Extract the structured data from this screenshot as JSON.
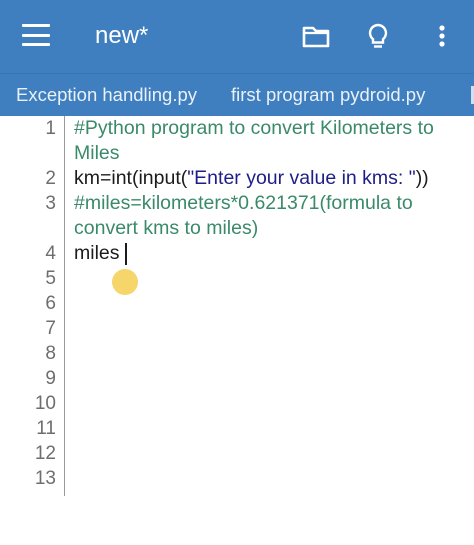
{
  "app_bar": {
    "title": "new*",
    "icons": [
      "menu-icon",
      "folder-icon",
      "lightbulb-icon",
      "more-vert-icon"
    ],
    "background": "#3f7fbf"
  },
  "tabs": [
    {
      "label": "Exception handling.py"
    },
    {
      "label": "first program pydroid.py"
    }
  ],
  "editor": {
    "line_numbers": [
      "1",
      "2",
      "3",
      "4",
      "5",
      "6",
      "7",
      "8",
      "9",
      "10",
      "11",
      "12",
      "13"
    ],
    "lines": [
      "#Python program to convert Kilometers to",
      "Miles",
      "km=int(input(",
      "\"Enter your value in kms: \"",
      "))",
      "#miles=kilometers*0.621371(formula to",
      "convert kms to miles)",
      "miles"
    ],
    "comment_color": "#3a8a6a",
    "string_color": "#1e1e88",
    "cursor_line": 4
  }
}
